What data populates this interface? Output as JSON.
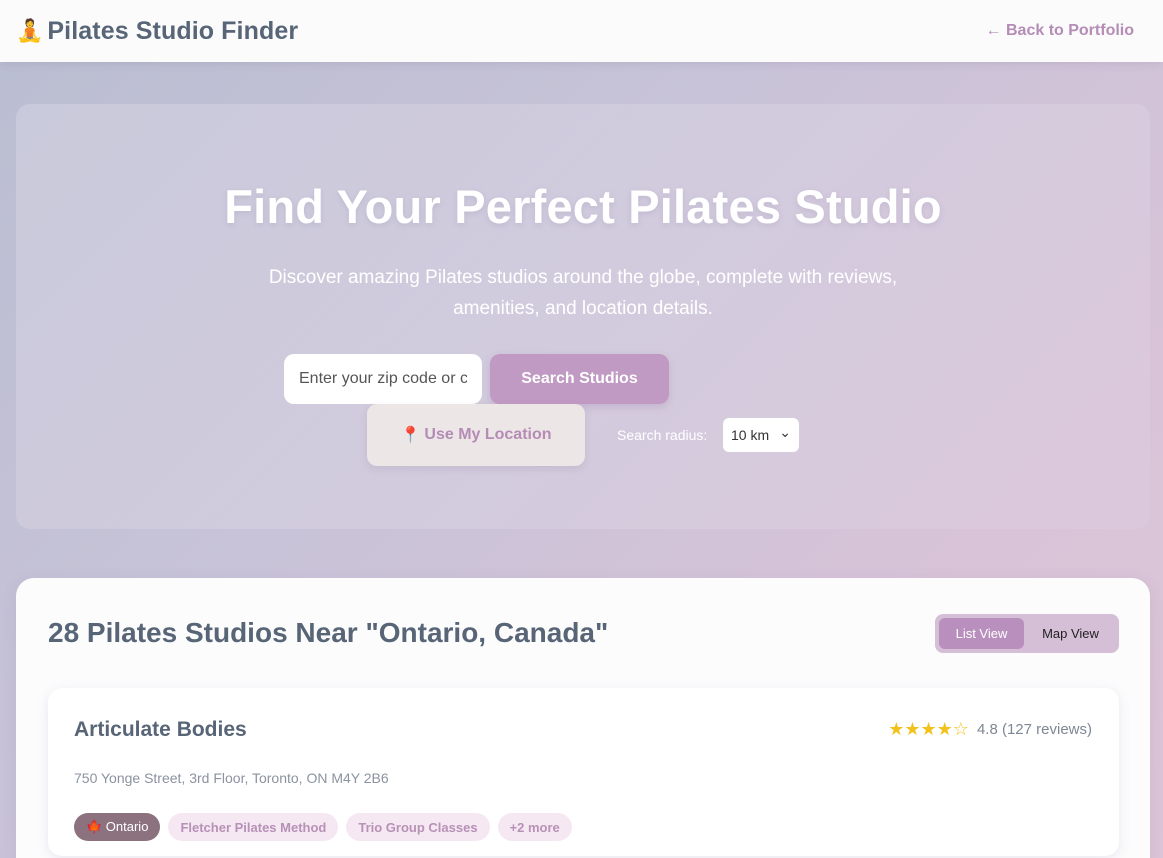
{
  "header": {
    "icon": "🧘",
    "title": "Pilates Studio Finder",
    "back_link": "← Back to Portfolio"
  },
  "hero": {
    "title": "Find Your Perfect Pilates Studio",
    "subtitle": "Discover amazing Pilates studios around the globe, complete with reviews, amenities, and location details.",
    "search_placeholder": "Enter your zip code or city",
    "search_button": "Search Studios",
    "location_icon": "📍",
    "location_button": "Use My Location",
    "radius_label": "Search radius:",
    "radius_value": "10 km",
    "radius_chevron": "⌄"
  },
  "results": {
    "title": "28 Pilates Studios Near \"Ontario, Canada\"",
    "view_toggle": {
      "list": "List View",
      "map": "Map View",
      "active": "List View"
    },
    "studios": [
      {
        "name": "Articulate Bodies",
        "stars": "★★★★☆",
        "rating": "4.8 (127 reviews)",
        "address": "750 Yonge Street, 3rd Floor, Toronto, ON M4Y 2B6",
        "region_tag": "🍁 Ontario",
        "tags": [
          "Fletcher Pilates Method",
          "Trio Group Classes",
          "+2 more"
        ]
      }
    ]
  },
  "colors": {
    "accent": "#c09ac2",
    "link": "#b48cb6",
    "star": "#f2c21b",
    "region_tag": "#8c717f"
  }
}
